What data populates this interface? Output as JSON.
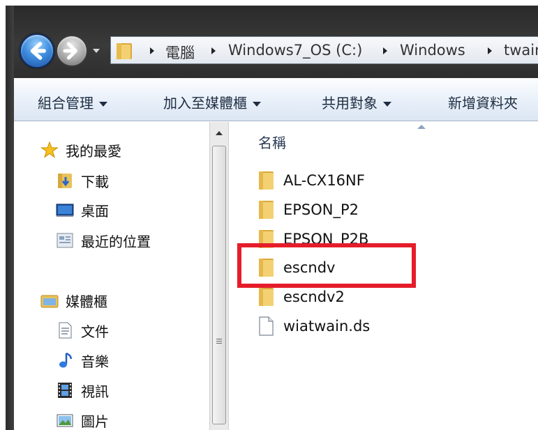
{
  "breadcrumb": {
    "items": [
      "電腦",
      "Windows7_OS (C:)",
      "Windows",
      "twain"
    ]
  },
  "toolbar": {
    "organize": "組合管理",
    "add_to_library": "加入至媒體櫃",
    "share_with": "共用對象",
    "new_folder": "新增資料夾"
  },
  "nav": {
    "favorites": "我的最愛",
    "downloads": "下載",
    "desktop": "桌面",
    "recent_places": "最近的位置",
    "libraries": "媒體櫃",
    "documents": "文件",
    "music": "音樂",
    "videos": "視訊",
    "pictures": "圖片"
  },
  "content": {
    "column_name": "名稱",
    "files": [
      {
        "name": "AL-CX16NF",
        "type": "folder"
      },
      {
        "name": "EPSON_P2",
        "type": "folder"
      },
      {
        "name": "EPSON_P2B",
        "type": "folder"
      },
      {
        "name": "escndv",
        "type": "folder"
      },
      {
        "name": "escndv2",
        "type": "folder"
      },
      {
        "name": "wiatwain.ds",
        "type": "file"
      }
    ]
  },
  "colors": {
    "highlight": "#e51d2a",
    "folder": "#e8c25a"
  }
}
